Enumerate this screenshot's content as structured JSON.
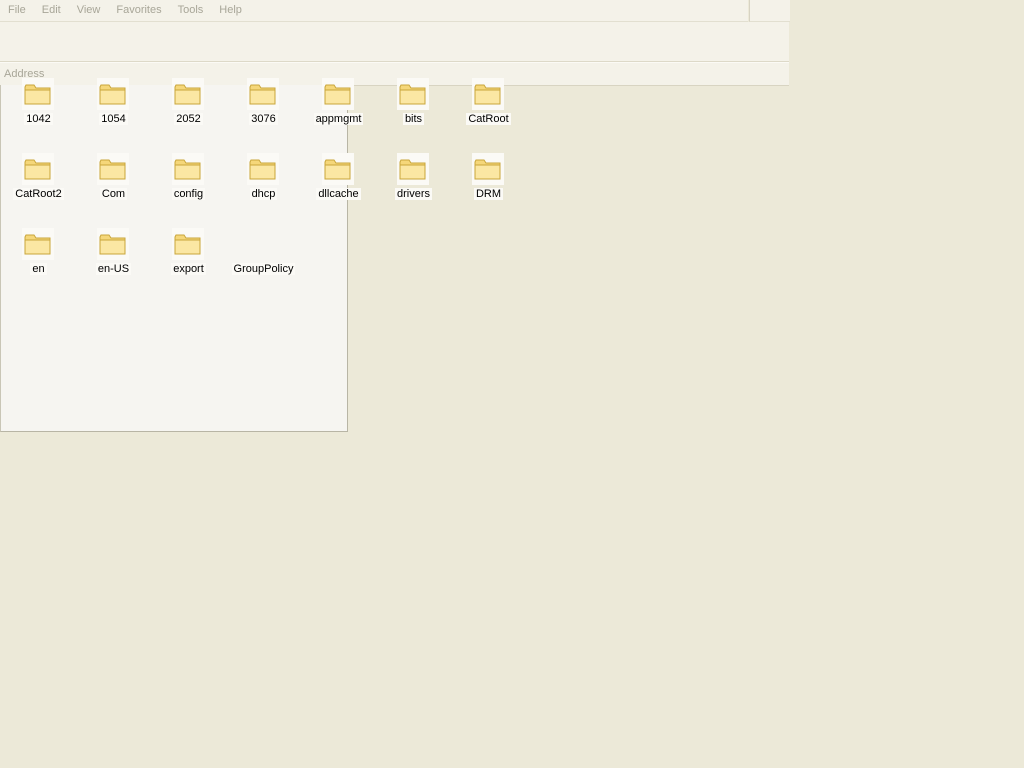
{
  "menubar": {
    "items": [
      "File",
      "Edit",
      "View",
      "Favorites",
      "Tools",
      "Help"
    ]
  },
  "addressbar": {
    "label": "Address"
  },
  "folders": [
    {
      "name": "1042"
    },
    {
      "name": "1054"
    },
    {
      "name": "2052"
    },
    {
      "name": "3076"
    },
    {
      "name": "appmgmt"
    },
    {
      "name": "bits"
    },
    {
      "name": "CatRoot"
    },
    {
      "name": "CatRoot2"
    },
    {
      "name": "Com"
    },
    {
      "name": "config"
    },
    {
      "name": "dhcp"
    },
    {
      "name": "dllcache"
    },
    {
      "name": "drivers"
    },
    {
      "name": "DRM"
    },
    {
      "name": "en"
    },
    {
      "name": "en-US"
    },
    {
      "name": "export"
    },
    {
      "name": "GroupPolicy"
    }
  ],
  "colors": {
    "background": "#ece9d8",
    "folder_fill": "#f5d77a",
    "folder_stroke": "#c9a53a",
    "menu_text_disabled": "#a8a698"
  },
  "icons": {
    "folder": "folder-icon"
  }
}
